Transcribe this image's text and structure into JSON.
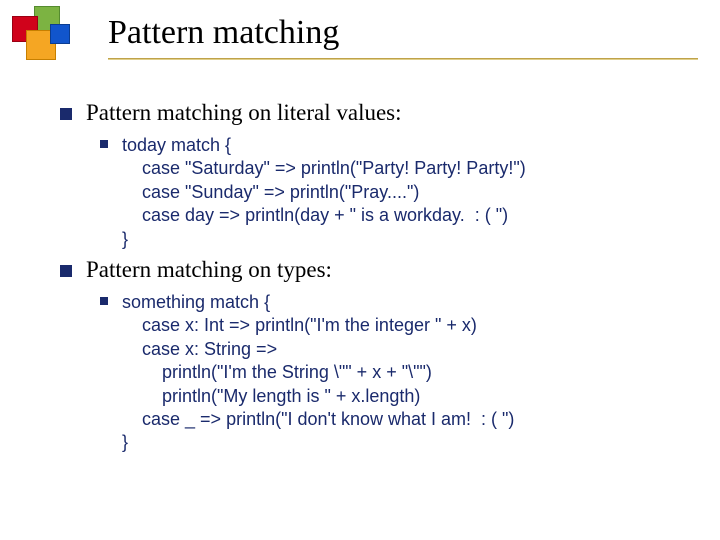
{
  "title": "Pattern matching",
  "sections": [
    {
      "heading": "Pattern matching on literal values:",
      "code": "today match {\n    case \"Saturday\" => println(\"Party! Party! Party!\")\n    case \"Sunday\" => println(\"Pray....\")\n    case day => println(day + \" is a workday.  : ( \")\n}"
    },
    {
      "heading": "Pattern matching on types:",
      "code": "something match {\n    case x: Int => println(\"I'm the integer \" + x)\n    case x: String =>\n        println(\"I'm the String \\\"\" + x + \"\\\"\")\n        println(\"My length is \" + x.length)\n    case _ => println(\"I don't know what I am!  : ( \")\n}"
    }
  ]
}
